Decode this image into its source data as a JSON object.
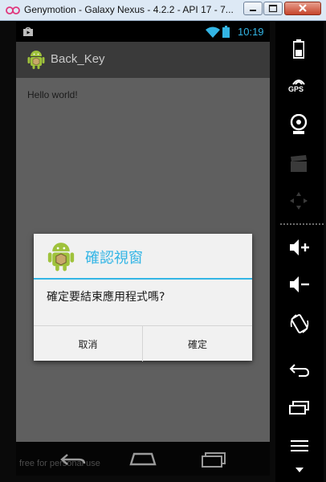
{
  "window": {
    "title": "Genymotion - Galaxy Nexus - 4.2.2 - API 17 - 7..."
  },
  "statusbar": {
    "time": "10:19"
  },
  "app": {
    "title": "Back_Key",
    "hello_text": "Hello world!"
  },
  "dialog": {
    "title": "確認視窗",
    "message": "確定要結束應用程式嗎?",
    "cancel_label": "取消",
    "ok_label": "確定"
  },
  "sidepanel": {
    "gps_label": "GPS"
  },
  "watermark": "free for personal use",
  "colors": {
    "accent": "#33b5e5",
    "android_green": "#9fc23b"
  }
}
